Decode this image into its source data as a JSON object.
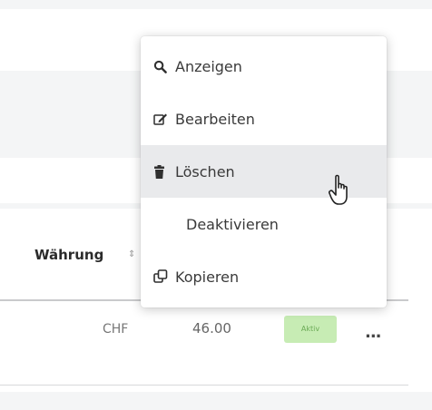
{
  "table": {
    "column_header": "Währung",
    "row": {
      "currency": "CHF",
      "amount": "46.00",
      "status": "Aktiv",
      "more": "..."
    }
  },
  "context_menu": {
    "items": [
      {
        "label": "Anzeigen",
        "icon": "search-icon"
      },
      {
        "label": "Bearbeiten",
        "icon": "edit-icon"
      },
      {
        "label": "Löschen",
        "icon": "trash-icon",
        "hovered": true
      },
      {
        "label": "Deaktivieren",
        "icon": null
      },
      {
        "label": "Kopieren",
        "icon": "copy-icon"
      }
    ]
  },
  "colors": {
    "status_badge_bg": "#c7ecb4",
    "status_badge_text": "#6aaa55",
    "menu_hover_bg": "#e9eaec",
    "band_bg": "#f4f5f6"
  }
}
